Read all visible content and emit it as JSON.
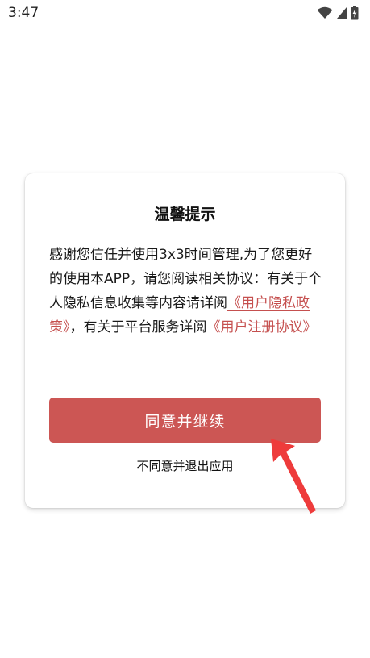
{
  "status_bar": {
    "time": "3:47",
    "icons": [
      "wifi-icon",
      "cell-signal-icon",
      "battery-charging-icon"
    ]
  },
  "dialog": {
    "title": "温馨提示",
    "body_pre": "感谢您信任并使用3x3时间管理,为了您更好的使用本APP，请您阅读相关协议：有关于个人隐私信息收集等内容请详阅",
    "privacy_link": "《用户隐私政策》",
    "body_mid": "，有关于平台服务详阅",
    "register_link": "《用户注册协议》",
    "agree_label": "同意并继续",
    "decline_label": "不同意并退出应用"
  },
  "colors": {
    "accent": "#cc5654",
    "link": "#c5504f",
    "annotation_arrow": "#ee3b3b"
  }
}
